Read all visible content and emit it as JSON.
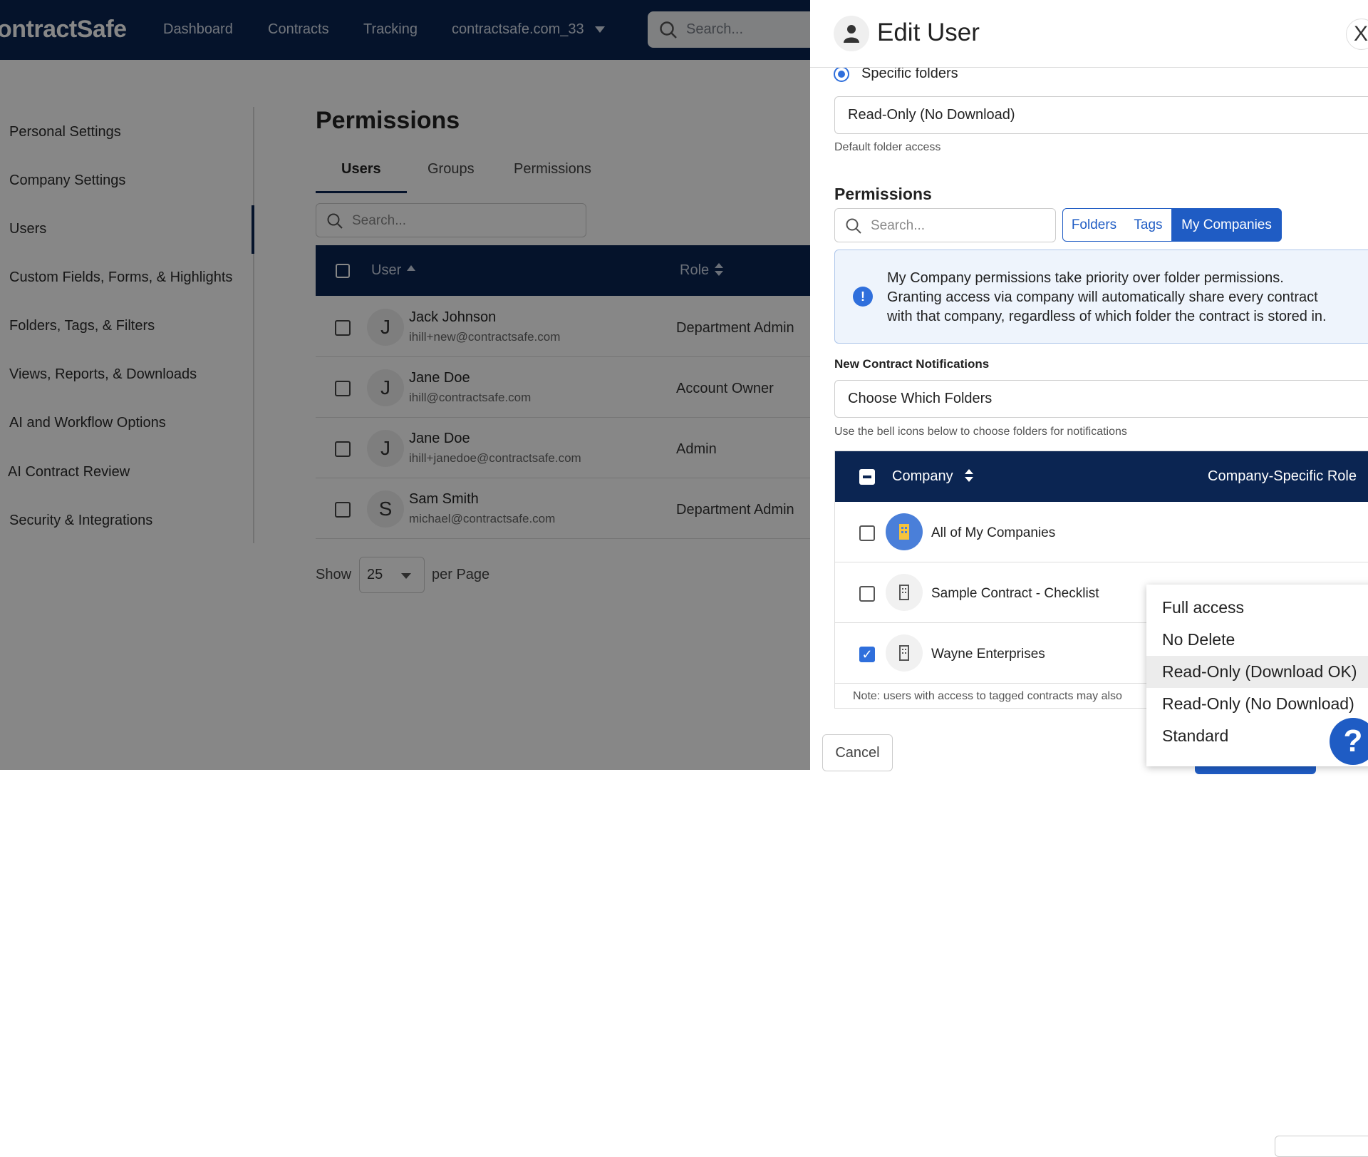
{
  "topbar": {
    "brand": "ontractSafe",
    "nav": [
      "Dashboard",
      "Contracts",
      "Tracking",
      "contractsafe.com_33"
    ],
    "search_placeholder": "Search..."
  },
  "sidebar": {
    "items": [
      {
        "label": "Personal Settings"
      },
      {
        "label": "Company Settings"
      },
      {
        "label": "Users"
      },
      {
        "label": "Custom Fields, Forms, & Highlights"
      },
      {
        "label": "Folders, Tags, & Filters"
      },
      {
        "label": "Views, Reports, & Downloads"
      },
      {
        "label": "AI and Workflow Options"
      },
      {
        "label": "AI Contract Review"
      },
      {
        "label": "Security & Integrations"
      }
    ]
  },
  "main": {
    "title": "Permissions",
    "tabs": [
      "Users",
      "Groups",
      "Permissions"
    ],
    "search_placeholder": "Search...",
    "columns": [
      "User",
      "Role"
    ],
    "rows": [
      {
        "initial": "J",
        "name": "Jack Johnson",
        "email": "ihill+new@contractsafe.com",
        "role": "Department Admin"
      },
      {
        "initial": "J",
        "name": "Jane Doe",
        "email": "ihill@contractsafe.com",
        "role": "Account Owner"
      },
      {
        "initial": "J",
        "name": "Jane Doe",
        "email": "ihill+janedoe@contractsafe.com",
        "role": "Admin"
      },
      {
        "initial": "S",
        "name": "Sam Smith",
        "email": "michael@contractsafe.com",
        "role": "Department Admin"
      }
    ],
    "show_label": "Show",
    "per_page_value": "25",
    "per_page_label": "per Page"
  },
  "panel": {
    "title": "Edit User",
    "close": "X",
    "specific_folders": "Specific folders",
    "folder_access_value": "Read-Only (No Download)",
    "folder_access_help": "Default folder access",
    "permissions_heading": "Permissions",
    "perm_search_placeholder": "Search...",
    "seg_tabs": [
      "Folders",
      "Tags",
      "My Companies"
    ],
    "info_lines": [
      "My Company permissions take priority over folder permissions.",
      "Granting access via company will automatically share every contract",
      "with that company, regardless of which folder the contract is stored in."
    ],
    "notifications_label": "New Contract Notifications",
    "notifications_value": "Choose Which Folders",
    "notifications_help": "Use the bell icons below to choose folders for notifications",
    "company_col": "Company",
    "role_col": "Company-Specific Role",
    "companies": [
      {
        "name": "All of My Companies",
        "checked": false
      },
      {
        "name": "Sample Contract - Checklist",
        "checked": false
      },
      {
        "name": "Wayne Enterprises",
        "checked": true
      }
    ],
    "note": "Note: users with access to tagged contracts may also",
    "cancel": "Cancel"
  },
  "dropdown": {
    "options": [
      "Full access",
      "No Delete",
      "Read-Only (Download OK)",
      "Read-Only (No Download)",
      "Standard"
    ],
    "highlighted": "Read-Only (Download OK)"
  },
  "help_icon": "?"
}
